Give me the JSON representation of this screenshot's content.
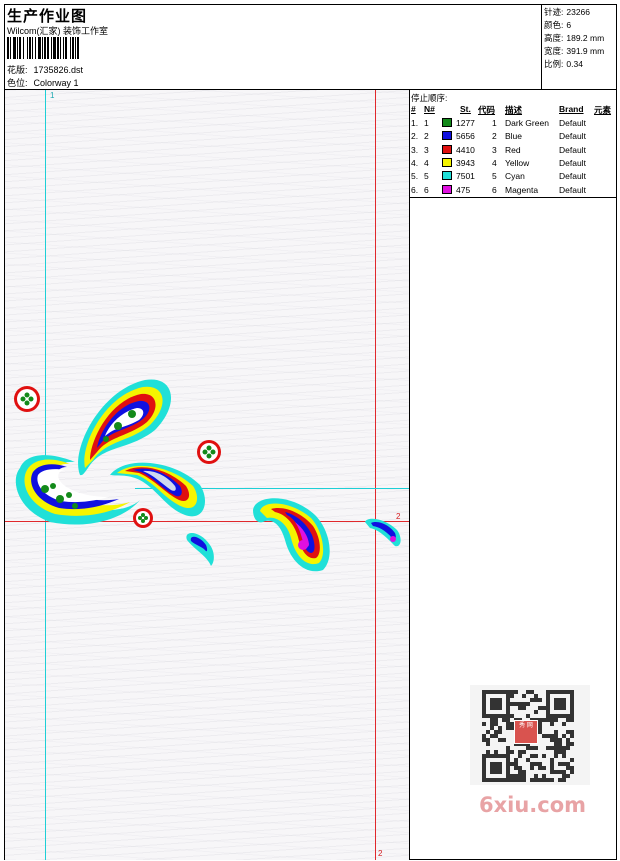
{
  "header": {
    "title": "生产作业图",
    "studio": "Wilcom(汇家) 装饰工作室",
    "design_label": "花版:",
    "design_file": "1735826.dst",
    "colorway_label": "色位:",
    "colorway": "Colorway 1"
  },
  "stats": {
    "stitches_label": "针迹:",
    "stitches": "23266",
    "colors_label": "颜色:",
    "colors": "6",
    "height_label": "高度:",
    "height": "189.2 mm",
    "width_label": "宽度:",
    "width": "391.9 mm",
    "scale_label": "比例:",
    "scale": "0.34"
  },
  "guides": {
    "v1_label": "1",
    "h2_label": "2",
    "v2_label": "2"
  },
  "stop_sequence": {
    "title": "停止顺序:",
    "headers": [
      "#",
      "N#",
      "St.",
      "代码",
      "描述",
      "Brand",
      "元素"
    ],
    "rows": [
      {
        "num": "1.",
        "n": "1",
        "stitches": "1277",
        "code": "1",
        "desc": "Dark Green",
        "brand": "Default",
        "color": "#138a1a"
      },
      {
        "num": "2.",
        "n": "2",
        "stitches": "5656",
        "code": "2",
        "desc": "Blue",
        "brand": "Default",
        "color": "#1010e0"
      },
      {
        "num": "3.",
        "n": "3",
        "stitches": "4410",
        "code": "3",
        "desc": "Red",
        "brand": "Default",
        "color": "#e01010"
      },
      {
        "num": "4.",
        "n": "4",
        "stitches": "3943",
        "code": "4",
        "desc": "Yellow",
        "brand": "Default",
        "color": "#f5f500"
      },
      {
        "num": "5.",
        "n": "5",
        "stitches": "7501",
        "code": "5",
        "desc": "Cyan",
        "brand": "Default",
        "color": "#20e0d8"
      },
      {
        "num": "6.",
        "n": "6",
        "stitches": "475",
        "code": "6",
        "desc": "Magenta",
        "brand": "Default",
        "color": "#e010e0"
      }
    ]
  },
  "watermark": {
    "text": "6xiu.com",
    "qr_logo": "秀 网"
  }
}
